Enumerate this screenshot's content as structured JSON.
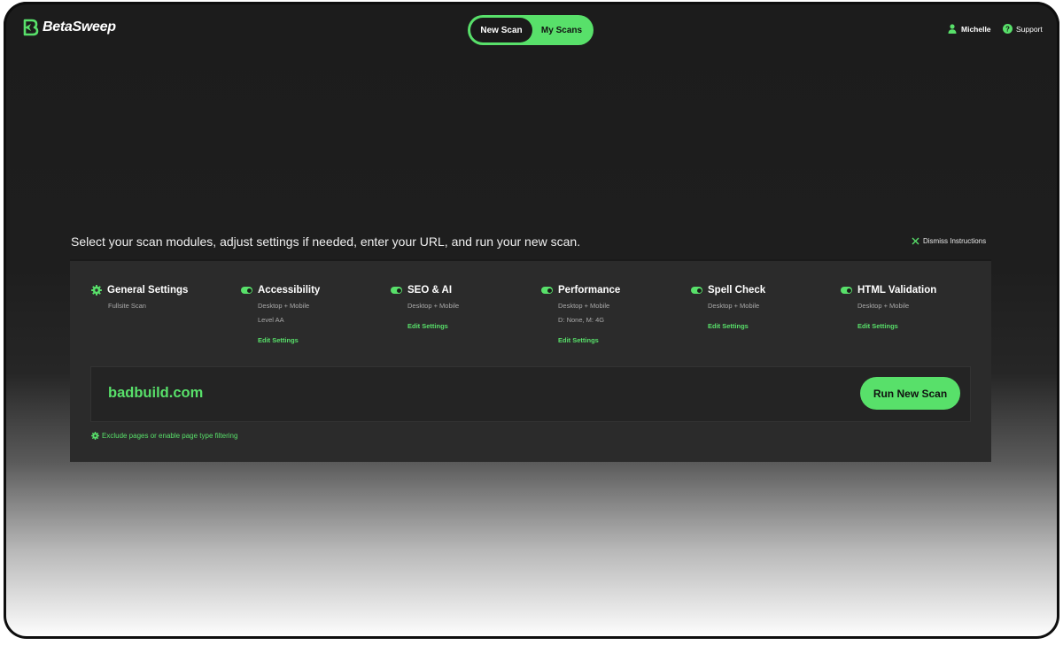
{
  "app": {
    "name": "BetaSweep"
  },
  "colors": {
    "accent": "#58e06a",
    "background": "#1e1e1e",
    "panel": "#2b2b2b"
  },
  "nav": {
    "tabs": [
      {
        "label": "New Scan",
        "active": true
      },
      {
        "label": "My Scans",
        "active": false
      }
    ],
    "user": {
      "name": "Michelle",
      "icon": "user-icon"
    },
    "support": {
      "label": "Support",
      "icon": "help-icon"
    }
  },
  "instructions": {
    "text": "Select your scan modules, adjust settings if needed, enter your URL, and run your new scan.",
    "dismiss_label": "Dismiss Instructions"
  },
  "modules": [
    {
      "title": "General Settings",
      "icon": "gear-icon",
      "lines": [
        "Fullsite Scan"
      ]
    },
    {
      "title": "Accessibility",
      "icon": "toggle-on",
      "lines": [
        "Desktop + Mobile",
        "Level AA"
      ],
      "edit_label": "Edit Settings"
    },
    {
      "title": "SEO & AI",
      "icon": "toggle-on",
      "lines": [
        "Desktop + Mobile"
      ],
      "edit_label": "Edit Settings"
    },
    {
      "title": "Performance",
      "icon": "toggle-on",
      "lines": [
        "Desktop + Mobile",
        "D: None, M: 4G"
      ],
      "edit_label": "Edit Settings"
    },
    {
      "title": "Spell Check",
      "icon": "toggle-on",
      "lines": [
        "Desktop + Mobile"
      ],
      "edit_label": "Edit Settings"
    },
    {
      "title": "HTML Validation",
      "icon": "toggle-on",
      "lines": [
        "Desktop + Mobile"
      ],
      "edit_label": "Edit Settings"
    }
  ],
  "scan": {
    "url": "badbuild.com",
    "run_label": "Run New Scan",
    "exclude_label": "Exclude pages or enable page type filtering"
  }
}
